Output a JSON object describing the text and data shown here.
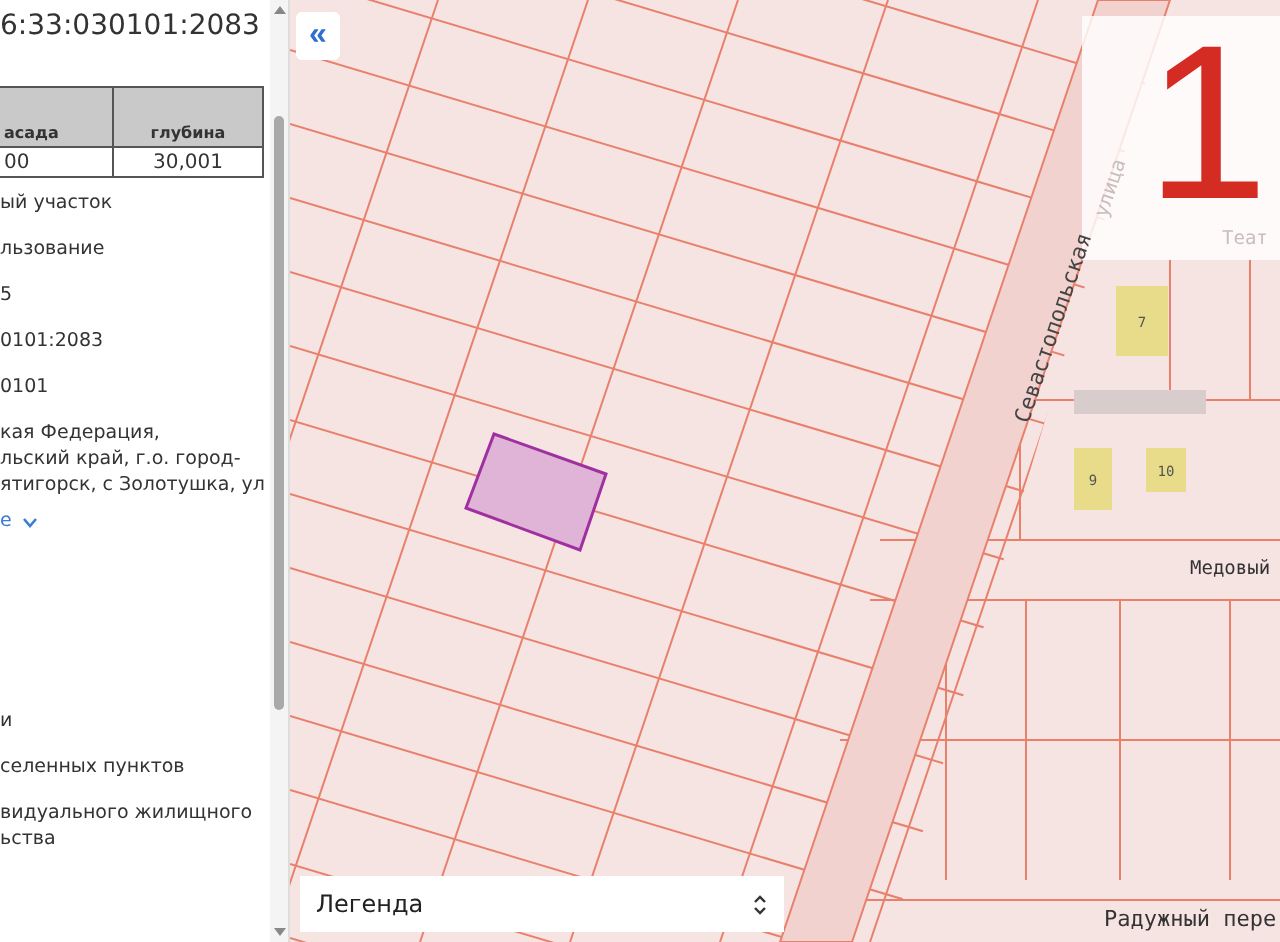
{
  "panel": {
    "title": "6:33:030101:2083",
    "table": {
      "columns": [
        "асада",
        "глубина"
      ],
      "rows": [
        [
          "00",
          "30,001"
        ]
      ]
    },
    "fields": [
      {
        "kind": "text",
        "value": "ый участок"
      },
      {
        "kind": "text",
        "value": "льзование"
      },
      {
        "kind": "text",
        "value": "5"
      },
      {
        "kind": "text",
        "value": "0101:2083"
      },
      {
        "kind": "text",
        "value": "0101"
      },
      {
        "kind": "paragraph",
        "value": "кая Федерация,\nльский край, г.о. город-\nятигорск, с Золотушка, ул"
      },
      {
        "kind": "link",
        "value": "е",
        "expanded": false
      },
      {
        "kind": "gap"
      },
      {
        "kind": "text",
        "value": "и"
      },
      {
        "kind": "text",
        "value": "селенных пунктов"
      },
      {
        "kind": "paragraph",
        "value": "видуального жилищного\nьства"
      }
    ]
  },
  "map": {
    "collapse_button": "«",
    "badge": "1",
    "labels": [
      {
        "kind": "street",
        "text": "Севастопольская"
      },
      {
        "kind": "street-faint",
        "text": "улица"
      },
      {
        "kind": "faint",
        "text": "Теат"
      },
      {
        "kind": "street",
        "text": "Медовый"
      },
      {
        "kind": "street",
        "text": "Радужный пере"
      }
    ],
    "buildings": [
      {
        "number": "7"
      },
      {
        "number": "9"
      },
      {
        "number": "10"
      }
    ],
    "legend_select": {
      "value": "Легенда"
    }
  }
}
